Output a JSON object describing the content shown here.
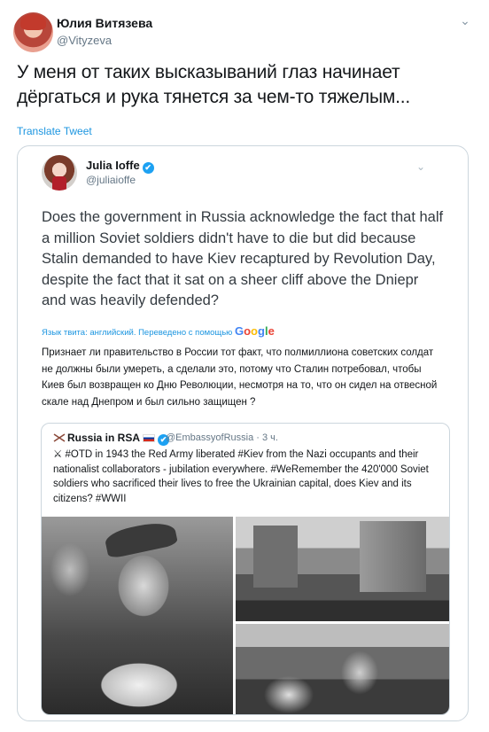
{
  "outer": {
    "name": "Юлия Витязева",
    "handle": "@Vityzeva",
    "text": "У меня от таких высказываний глаз начинает дёргаться и рука тянется за чем-то тяжелым...",
    "translate_label": "Translate Tweet"
  },
  "quoted": {
    "name": "Julia Ioffe",
    "verified_icon": "✔",
    "handle": "@juliaioffe",
    "text": "Does the government in Russia acknowledge the fact that half a million Soviet soldiers didn't have to die but did because Stalin demanded to have Kiev recaptured by Revolution Day, despite the fact that it sat on a sheer cliff above the Dniepr and was heavily defended?",
    "translated_by": "Язык твита: английский. Переведено с помощью",
    "google": [
      "G",
      "o",
      "o",
      "g",
      "l",
      "e"
    ],
    "text_ru": "Признает ли правительство в России тот факт, что полмиллиона советских солдат не должны были умереть, а сделали это, потому что Сталин потребовал, чтобы Киев был возвращен ко Дню Революции, несмотря на то, что он сидел на отвесной скале над Днепром и был сильно защищен ?"
  },
  "nested": {
    "name": "Russia in RSA",
    "verified_icon": "✔",
    "handle": "@EmbassyofRussia · 3 ч.",
    "text": "⚔ #OTD in 1943 the Red Army liberated #Kiev from the Nazi occupants and their nationalist collaborators - jubilation everywhere. #WeRemember the 420'000 Soviet soldiers who sacrificed their lives to free the Ukrainian capital, does Kiev and its citizens? #WWII"
  },
  "icons": {
    "chevron": "⌄"
  },
  "colors": {
    "link": "#1b95e0",
    "verified": "#1da1f2",
    "muted": "#657786"
  }
}
